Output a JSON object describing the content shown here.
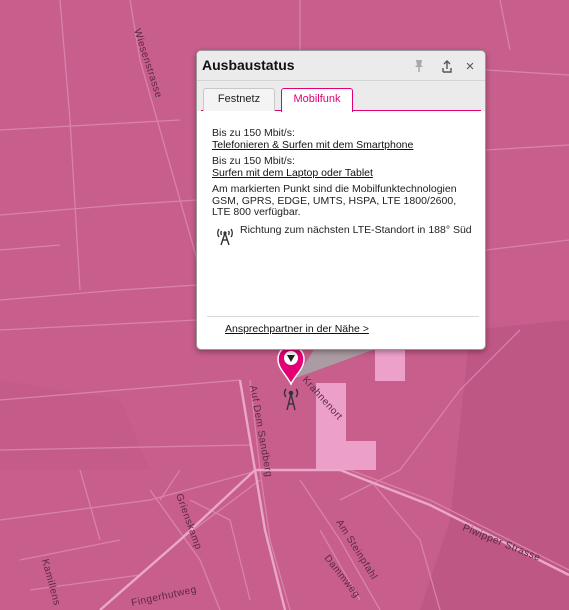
{
  "map": {
    "streets": {
      "wiesenstrasse": "Wiesenstrasse",
      "auf_dem_sandberg": "Auf Dem Sandberg",
      "krahnenort": "Krahnenort",
      "grienskamp": "Grienskamp",
      "am_steinpfahl": "Am Steinpfahl",
      "piwipper_strasse": "Piwipper Strasse",
      "dammweg": "Dammweg",
      "fingerhutweg": "Fingerhutweg",
      "kamillens": "Kamillens"
    },
    "colors": {
      "background": "#c85e8c",
      "coverage_highlight": "#f1a8d0",
      "marker": "#e20074"
    },
    "icons": {
      "marker": "location-pin-icon",
      "tower": "antenna-tower-icon"
    }
  },
  "popup": {
    "title": "Ausbaustatus",
    "header_icons": [
      "pin-icon",
      "share-icon",
      "close-icon"
    ],
    "close_glyph": "×",
    "tabs": [
      {
        "label": "Festnetz",
        "active": false
      },
      {
        "label": "Mobilfunk",
        "active": true
      }
    ],
    "content": {
      "speed1_heading": "Bis zu 150 Mbit/s:",
      "speed1_link": "Telefonieren & Surfen mit dem Smartphone",
      "speed2_heading": "Bis zu 150 Mbit/s:",
      "speed2_link": "Surfen mit dem Laptop oder Tablet",
      "tech_info": "Am markierten Punkt sind die Mobilfunktechnologien GSM, GPRS, EDGE, UMTS, HSPA, LTE 1800/2600, LTE 800 verfügbar.",
      "lte_direction": "Richtung zum nächsten LTE-Standort in 188° Süd"
    },
    "footer_link": "Ansprechpartner in der Nähe >"
  }
}
